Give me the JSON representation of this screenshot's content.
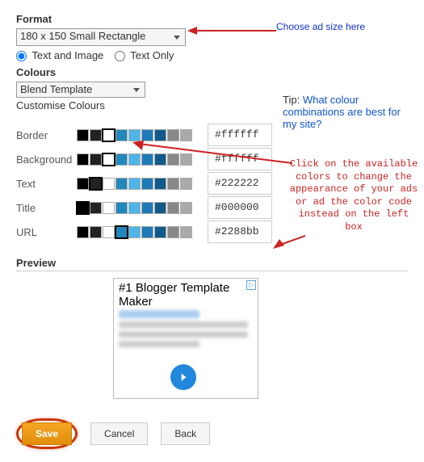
{
  "format": {
    "label": "Format",
    "selected": "180 x 150 Small Rectangle",
    "radio1": "Text and Image",
    "radio2": "Text Only"
  },
  "colours": {
    "label": "Colours",
    "template_selected": "Blend Template",
    "customise_label": "Customise Colours",
    "tip_label": "Tip:",
    "tip_link": "What colour combinations are best for my site?"
  },
  "rows": [
    {
      "label": "Border",
      "hex": "#ffffff",
      "selected_index": 2
    },
    {
      "label": "Background",
      "hex": "#ffffff",
      "selected_index": 2
    },
    {
      "label": "Text",
      "hex": "#222222",
      "selected_index": 1
    },
    {
      "label": "Title",
      "hex": "#000000",
      "selected_index": 0
    },
    {
      "label": "URL",
      "hex": "#2288bb",
      "selected_index": 3
    }
  ],
  "palette": [
    "#000000",
    "#222222",
    "#ffffff",
    "#2288bb",
    "#4fb4e8",
    "#1e7bb8",
    "#125a8a",
    "#888888",
    "#aaaaaa"
  ],
  "preview": {
    "label": "Preview",
    "ad_title": "#1 Blogger Template Maker"
  },
  "buttons": {
    "save": "Save",
    "cancel": "Cancel",
    "back": "Back"
  },
  "annotations": {
    "a1": "Choose ad size here",
    "a2": "Click on the available colors to change the appearance of your ads or ad the color code instead on the left box"
  }
}
